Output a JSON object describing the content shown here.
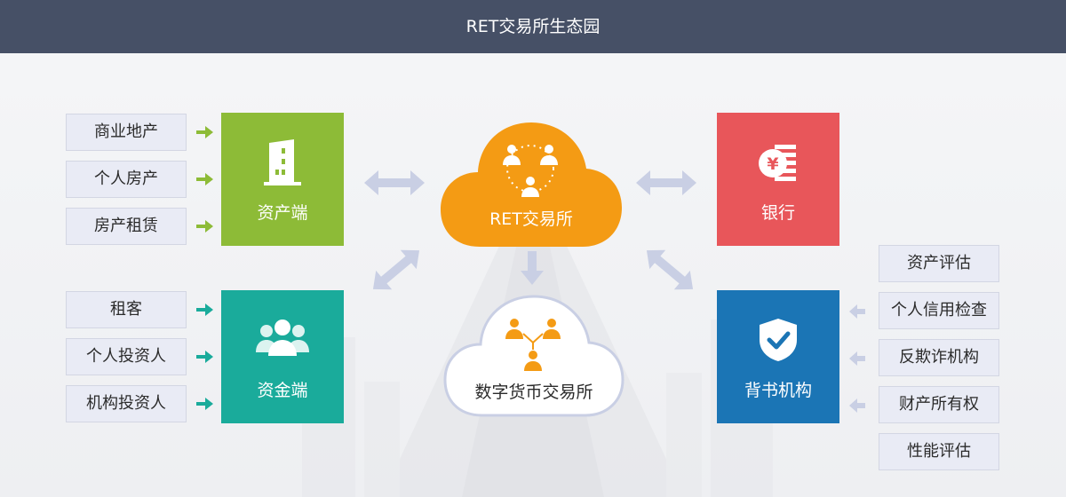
{
  "header": {
    "title": "RET交易所生态园"
  },
  "asset_side": {
    "title": "资产端",
    "color": "#8dbb37",
    "inputs": [
      "商业地产",
      "个人房产",
      "房产租赁"
    ]
  },
  "fund_side": {
    "title": "资金端",
    "color": "#1aab9b",
    "inputs": [
      "租客",
      "个人投资人",
      "机构投资人"
    ]
  },
  "exchange": {
    "title": "RET交易所",
    "color": "#f49b14"
  },
  "digital_exchange": {
    "title": "数字货币交易所"
  },
  "bank": {
    "title": "银行",
    "color": "#e8565a",
    "icon_text": "¥"
  },
  "endorsement": {
    "title": "背书机构",
    "color": "#1b75b5",
    "inputs": [
      "资产评估",
      "个人信用检查",
      "反欺诈机构",
      "财产所有权",
      "性能评估"
    ]
  },
  "colors": {
    "header_bg": "#465066",
    "arrow_light": "#c9cfe4",
    "arrow_green": "#8dbb37",
    "arrow_teal": "#1aab9b",
    "orange_icon": "#f49b14"
  }
}
